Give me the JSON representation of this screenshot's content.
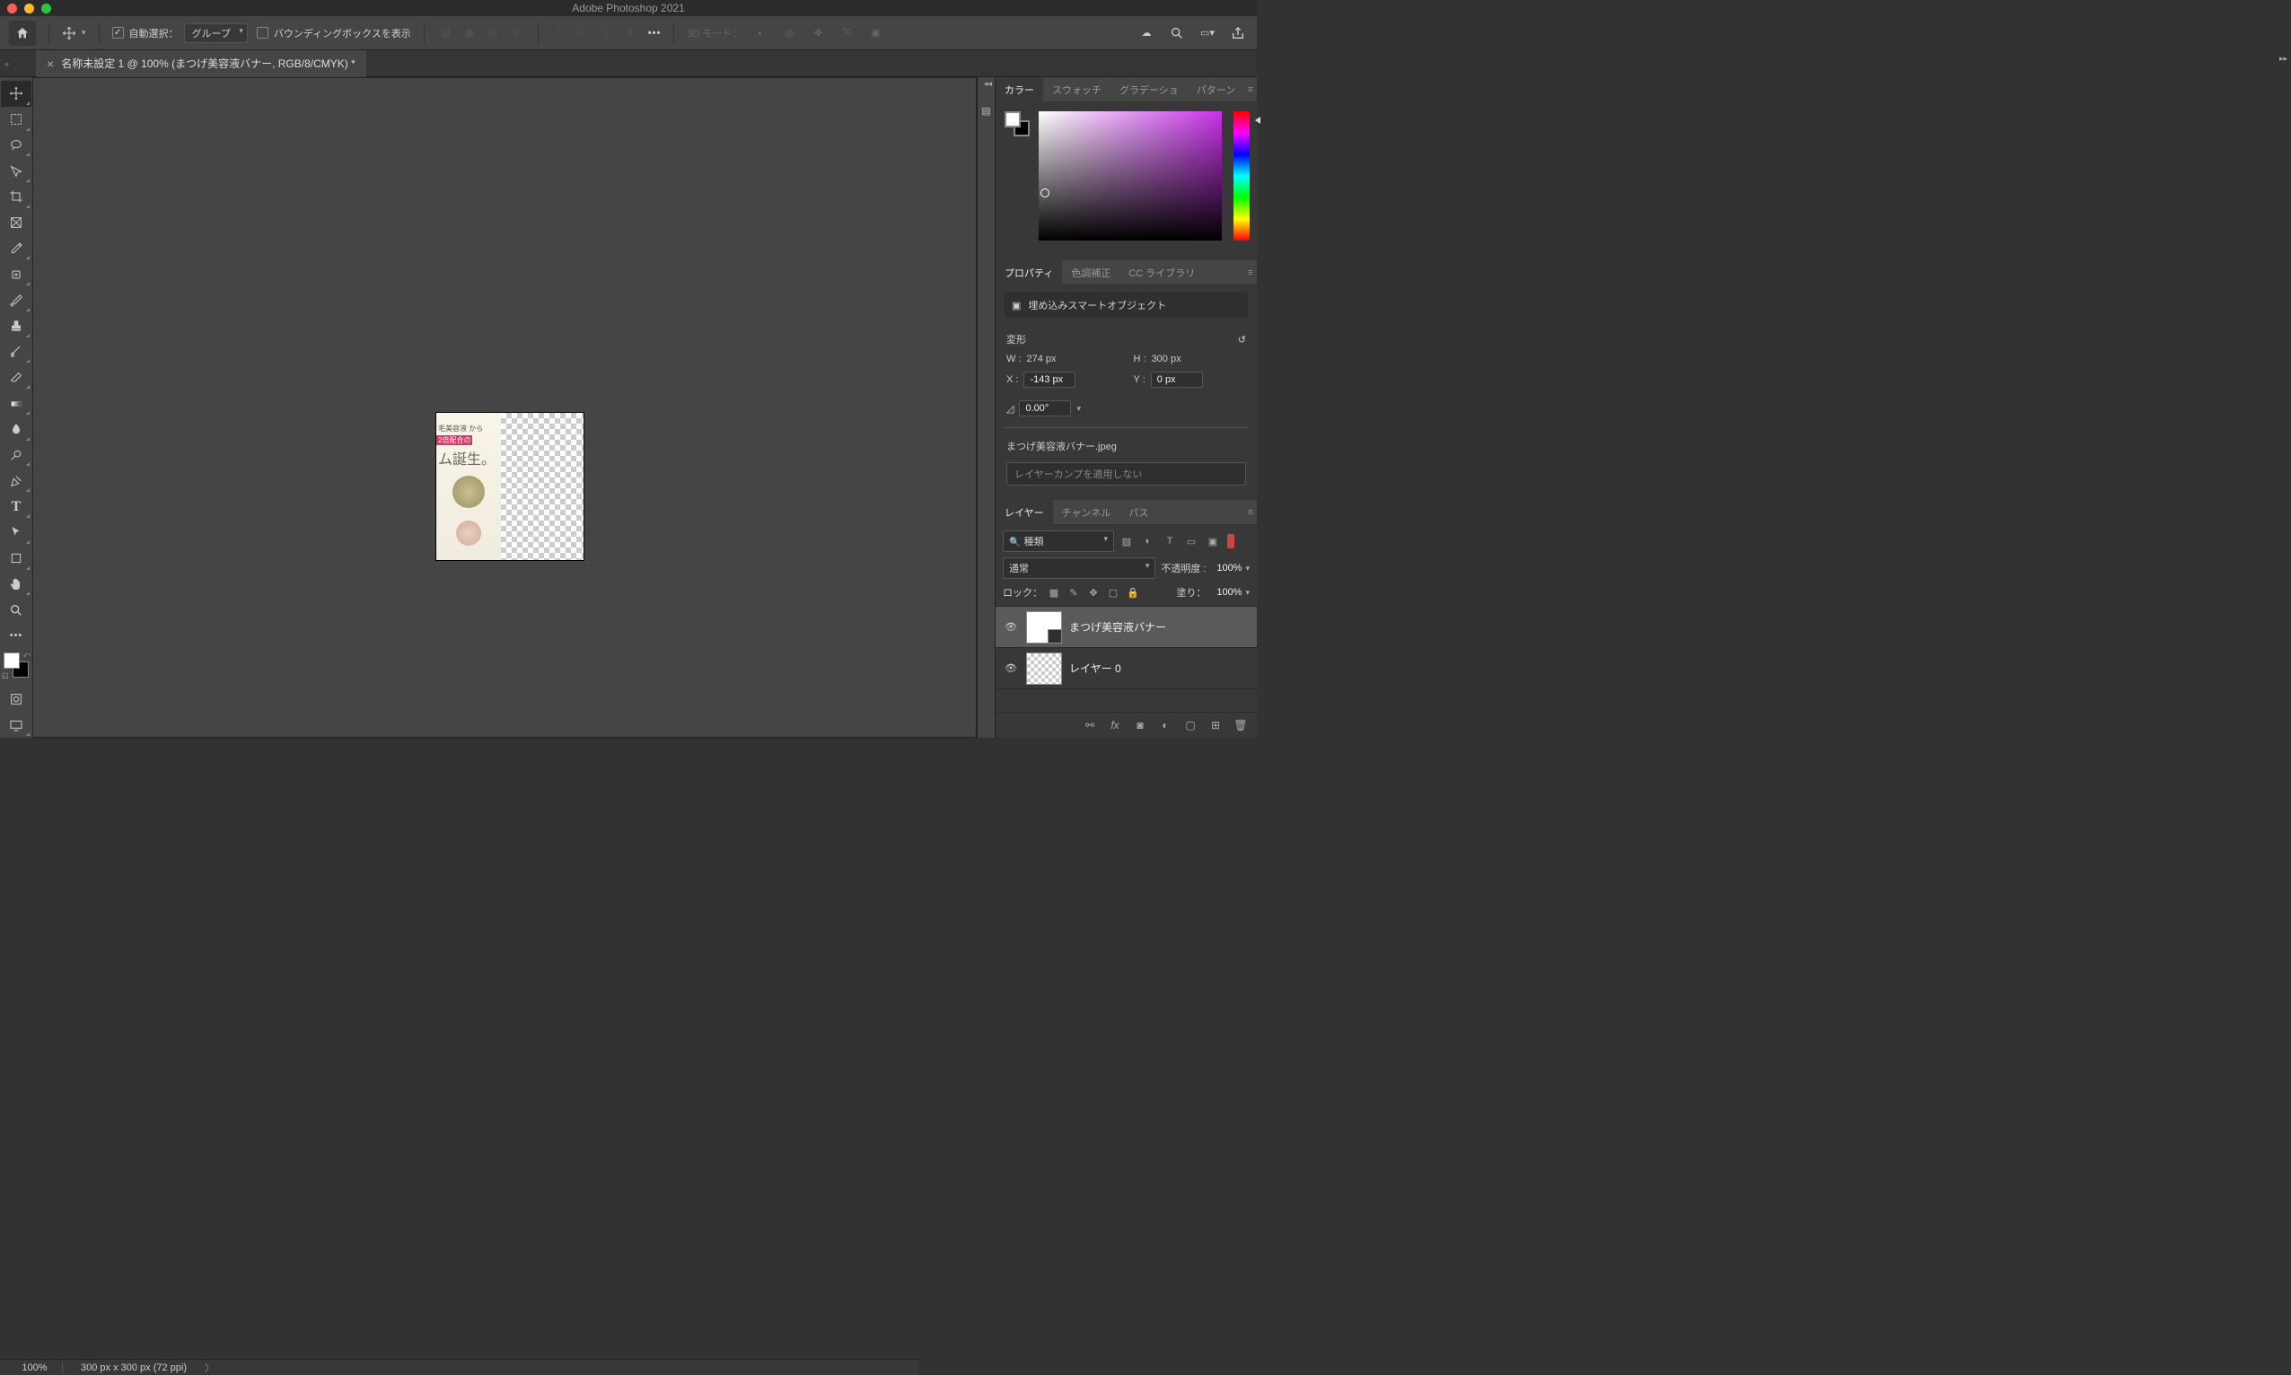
{
  "app_title": "Adobe Photoshop 2021",
  "options_bar": {
    "auto_select_label": "自動選択：",
    "auto_select_checked": true,
    "auto_select_target": "グループ",
    "show_bbox_label": "バウンディングボックスを表示",
    "show_bbox_checked": false,
    "mode_3d_label": "3D モード："
  },
  "document_tab": {
    "title": "名称未設定 1 @ 100% (まつげ美容液バナー, RGB/8/CMYK) *"
  },
  "canvas_image": {
    "text1": "毛美容液 から",
    "text2": "2倍配合の",
    "text3": "ム誕生。"
  },
  "panels": {
    "color": {
      "tabs": [
        "カラー",
        "スウォッチ",
        "グラデーショ",
        "パターン"
      ],
      "active": 0
    },
    "properties": {
      "tabs": [
        "プロパティ",
        "色調補正",
        "CC ライブラリ"
      ],
      "active": 0,
      "object_type": "埋め込みスマートオブジェクト",
      "transform_label": "変形",
      "w_label": "W :",
      "w_value": "274 px",
      "h_label": "H :",
      "h_value": "300 px",
      "x_label": "X :",
      "x_value": "-143 px",
      "y_label": "Y :",
      "y_value": "0 px",
      "angle": "0.00°",
      "filename": "まつげ美容液バナー.jpeg",
      "layercomp_placeholder": "レイヤーカンプを適用しない"
    },
    "layers": {
      "tabs": [
        "レイヤー",
        "チャンネル",
        "パス"
      ],
      "active": 0,
      "kind_label": "種類",
      "blend_mode": "通常",
      "opacity_label": "不透明度 :",
      "opacity_value": "100%",
      "lock_label": "ロック：",
      "fill_label": "塗り：",
      "fill_value": "100%",
      "items": [
        {
          "name": "まつげ美容液バナー",
          "visible": true,
          "selected": true,
          "smart": true
        },
        {
          "name": "レイヤー 0",
          "visible": true,
          "selected": false,
          "transparent": true
        }
      ]
    }
  },
  "status": {
    "zoom": "100%",
    "doc_info": "300 px x 300 px (72 ppi)"
  }
}
